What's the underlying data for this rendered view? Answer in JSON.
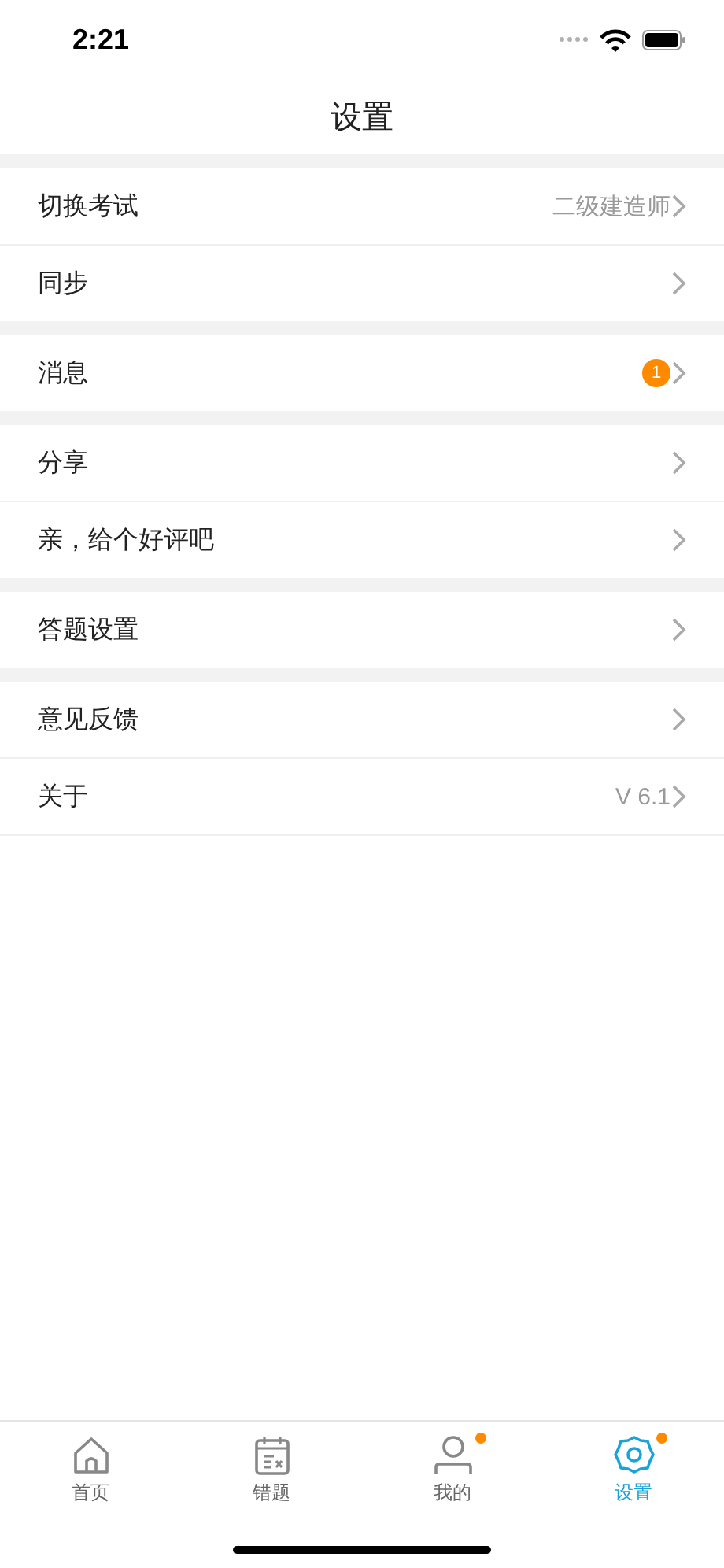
{
  "status_bar": {
    "time": "2:21"
  },
  "nav_bar": {
    "title": "设置"
  },
  "groups": [
    {
      "items": [
        {
          "label": "切换考试",
          "value": "二级建造师"
        },
        {
          "label": "同步"
        }
      ]
    },
    {
      "items": [
        {
          "label": "消息",
          "badge": "1"
        }
      ]
    },
    {
      "items": [
        {
          "label": "分享"
        },
        {
          "label": "亲，给个好评吧"
        }
      ]
    },
    {
      "items": [
        {
          "label": "答题设置"
        }
      ]
    },
    {
      "items": [
        {
          "label": "意见反馈"
        },
        {
          "label": "关于",
          "value": "V 6.1"
        }
      ]
    }
  ],
  "tab_bar": [
    {
      "kind": "home",
      "label": "首页",
      "selected": false,
      "dot": false
    },
    {
      "kind": "mistakes",
      "label": "错题",
      "selected": false,
      "dot": false
    },
    {
      "kind": "profile",
      "label": "我的",
      "selected": false,
      "dot": true
    },
    {
      "kind": "settings",
      "label": "设置",
      "selected": true,
      "dot": true
    }
  ]
}
